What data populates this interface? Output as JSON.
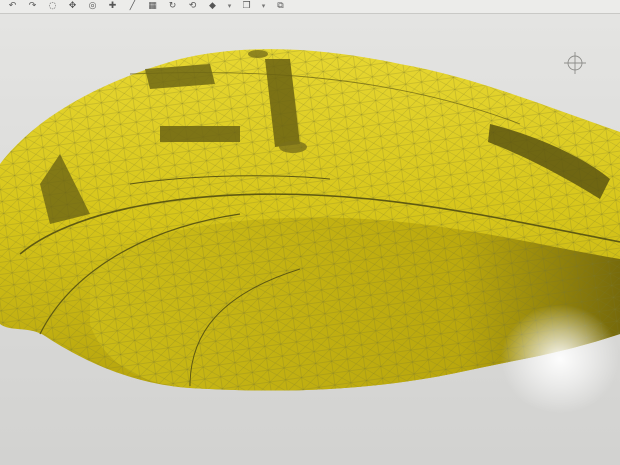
{
  "toolbar": {
    "icons": [
      "undo-icon",
      "redo-icon",
      "lasso-select-icon",
      "orbit-icon",
      "target-icon",
      "move-icon",
      "sketch-line-icon",
      "extrude-icon",
      "rotate-icon",
      "revolve-icon",
      "appearance-icon",
      "view-cube-icon",
      "view-options-icon"
    ]
  },
  "viewport": {
    "model": "yellow-mesh-shell",
    "mesh_color": "#d9c81c",
    "background_color": "#dcdcda"
  }
}
